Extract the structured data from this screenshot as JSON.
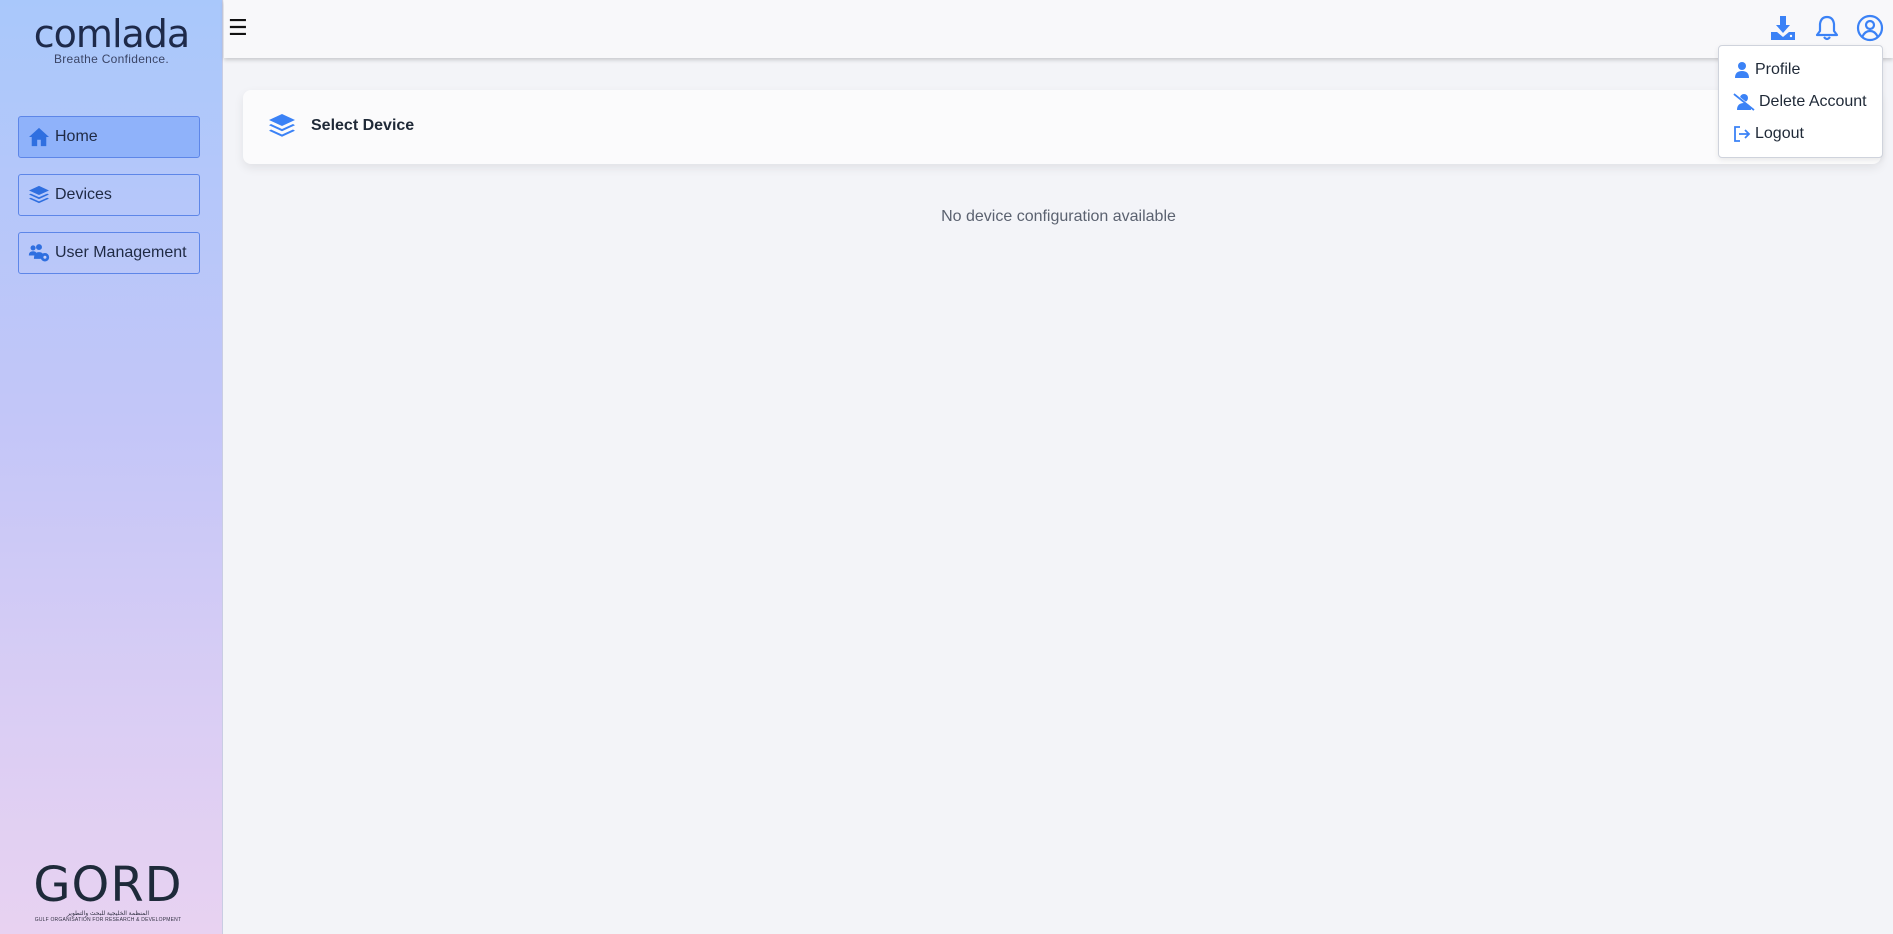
{
  "sidebar": {
    "logo_text": "comlada",
    "logo_tagline": "Breathe Confidence.",
    "nav": [
      {
        "label": "Home",
        "icon": "home-icon",
        "active": true
      },
      {
        "label": "Devices",
        "icon": "layers-icon",
        "active": false
      },
      {
        "label": "User Management",
        "icon": "users-gear-icon",
        "active": false
      }
    ],
    "footer_logo_text": "GORD",
    "footer_logo_arabic": "المنظمة الخليجية للبحث والتطوير",
    "footer_logo_english": "GULF ORGANISATION FOR RESEARCH & DEVELOPMENT"
  },
  "topbar": {
    "menu_icon": "hamburger-icon",
    "icons": [
      "download-icon",
      "bell-icon",
      "user-circle-icon"
    ]
  },
  "user_menu": {
    "items": [
      {
        "label": "Profile",
        "icon": "user-icon"
      },
      {
        "label": "Delete Account",
        "icon": "user-slash-icon"
      },
      {
        "label": "Logout",
        "icon": "logout-icon"
      }
    ]
  },
  "main": {
    "card_title": "Select Device",
    "empty_message": "No device configuration available"
  },
  "colors": {
    "accent": "#3b82f6",
    "nav_active": "#8fb2fa",
    "nav_border": "#5d86e8"
  }
}
